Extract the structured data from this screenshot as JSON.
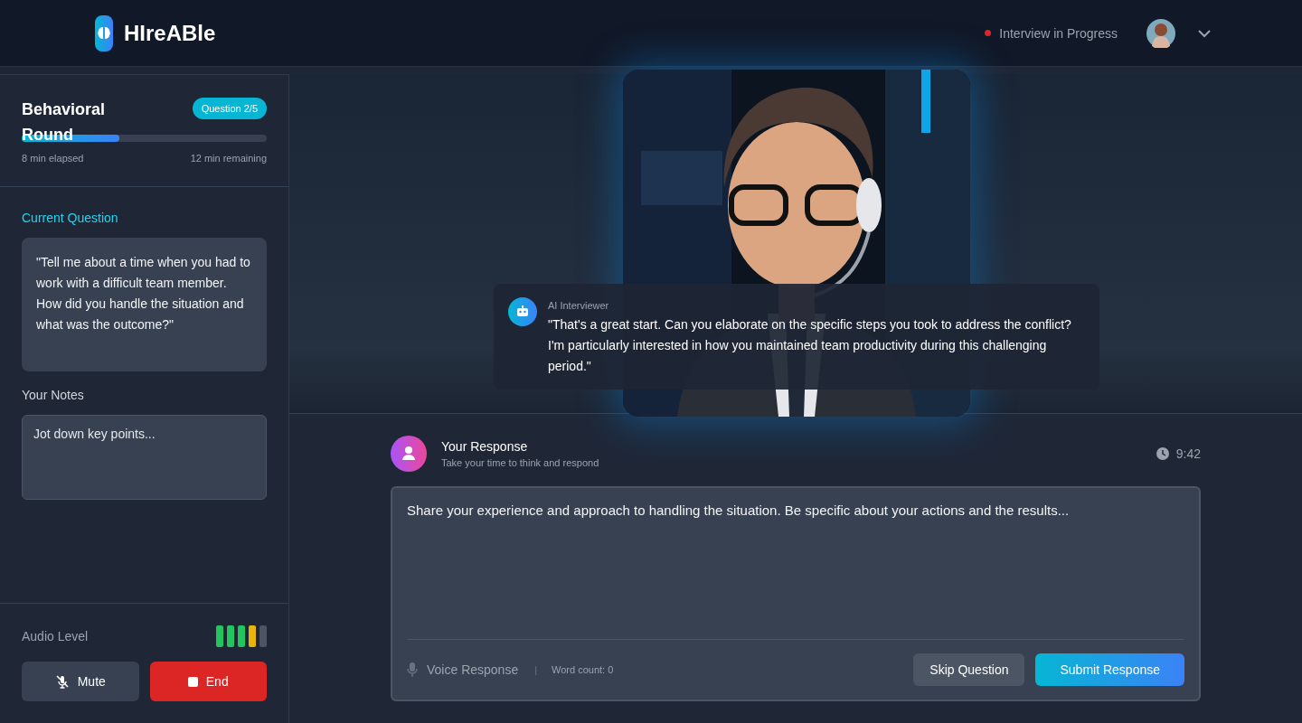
{
  "header": {
    "brand": "HIreABle",
    "status": {
      "label": "Interview in Progress",
      "color": "#dc2626"
    }
  },
  "sidebar": {
    "round_title": "Behavioral Round",
    "question_badge": "Question 2/5",
    "progress": {
      "level": 0.4
    },
    "elapsed": "8 min elapsed",
    "remaining": "12 min remaining",
    "current_question_label": "Current Question",
    "current_question": "\"Tell me about a time when you had to work with a difficult team member. How did you handle the situation and what was the outcome?\"",
    "notes_label": "Your Notes",
    "notes_placeholder": "Jot down key points...",
    "audio_label": "Audio Level",
    "audio": {
      "level": 0.8
    },
    "buttons": [
      {
        "kind": "mute",
        "label": "Mute"
      },
      {
        "kind": "end",
        "label": "End"
      }
    ]
  },
  "video": {
    "kind": "picture",
    "message": {
      "sender": "AI Interviewer",
      "text": "\"That's a great start. Can you elaborate on the specific steps you took to address the conflict? I'm particularly interested in how you maintained team productivity during this challenging period.\""
    }
  },
  "response": {
    "title": "Your Response",
    "subtitle": "Take your time to think and respond",
    "timer": "9:42",
    "placeholder": "Share your experience and approach to handling the situation. Be specific about your actions and the results...",
    "voice_label": "Voice Response",
    "separator": "|",
    "word_count": "Word count: 0",
    "buttons": [
      {
        "kind": "secondary",
        "label": "Skip Question"
      },
      {
        "kind": "primary",
        "label": "Submit Response"
      }
    ]
  }
}
